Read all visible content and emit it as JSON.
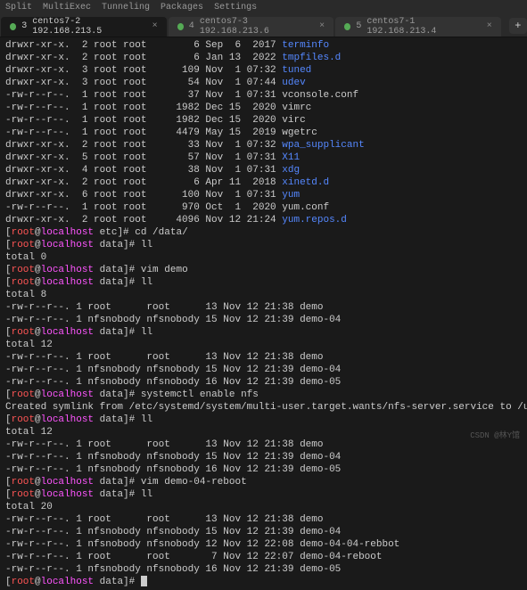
{
  "menubar": {
    "items": [
      "Split",
      "MultiExec",
      "Tunneling",
      "Packages",
      "Settings"
    ]
  },
  "tabs": [
    {
      "num": "3",
      "label": "centos7-2 192.168.213.5",
      "active": true
    },
    {
      "num": "4",
      "label": "centos7-3 192.168.213.6",
      "active": false
    },
    {
      "num": "5",
      "label": "centos7-1 192.168.213.4",
      "active": false
    }
  ],
  "ls1": [
    {
      "perm": "drwxr-xr-x.",
      "n": "2",
      "u": "root",
      "g": "root",
      "sz": "6",
      "mon": "Sep",
      "d": "6",
      "yt": "2017",
      "name": "terminfo",
      "cls": "blue"
    },
    {
      "perm": "drwxr-xr-x.",
      "n": "2",
      "u": "root",
      "g": "root",
      "sz": "6",
      "mon": "Jan",
      "d": "13",
      "yt": "2022",
      "name": "tmpfiles.d",
      "cls": "blue"
    },
    {
      "perm": "drwxr-xr-x.",
      "n": "3",
      "u": "root",
      "g": "root",
      "sz": "109",
      "mon": "Nov",
      "d": "1",
      "yt": "07:32",
      "name": "tuned",
      "cls": "blue"
    },
    {
      "perm": "drwxr-xr-x.",
      "n": "3",
      "u": "root",
      "g": "root",
      "sz": "54",
      "mon": "Nov",
      "d": "1",
      "yt": "07:44",
      "name": "udev",
      "cls": "blue"
    },
    {
      "perm": "-rw-r--r--.",
      "n": "1",
      "u": "root",
      "g": "root",
      "sz": "37",
      "mon": "Nov",
      "d": "1",
      "yt": "07:31",
      "name": "vconsole.conf",
      "cls": "white"
    },
    {
      "perm": "-rw-r--r--.",
      "n": "1",
      "u": "root",
      "g": "root",
      "sz": "1982",
      "mon": "Dec",
      "d": "15",
      "yt": "2020",
      "name": "vimrc",
      "cls": "white"
    },
    {
      "perm": "-rw-r--r--.",
      "n": "1",
      "u": "root",
      "g": "root",
      "sz": "1982",
      "mon": "Dec",
      "d": "15",
      "yt": "2020",
      "name": "virc",
      "cls": "white"
    },
    {
      "perm": "-rw-r--r--.",
      "n": "1",
      "u": "root",
      "g": "root",
      "sz": "4479",
      "mon": "May",
      "d": "15",
      "yt": "2019",
      "name": "wgetrc",
      "cls": "white"
    },
    {
      "perm": "drwxr-xr-x.",
      "n": "2",
      "u": "root",
      "g": "root",
      "sz": "33",
      "mon": "Nov",
      "d": "1",
      "yt": "07:32",
      "name": "wpa_supplicant",
      "cls": "blue"
    },
    {
      "perm": "drwxr-xr-x.",
      "n": "5",
      "u": "root",
      "g": "root",
      "sz": "57",
      "mon": "Nov",
      "d": "1",
      "yt": "07:31",
      "name": "X11",
      "cls": "blue"
    },
    {
      "perm": "drwxr-xr-x.",
      "n": "4",
      "u": "root",
      "g": "root",
      "sz": "38",
      "mon": "Nov",
      "d": "1",
      "yt": "07:31",
      "name": "xdg",
      "cls": "blue"
    },
    {
      "perm": "drwxr-xr-x.",
      "n": "2",
      "u": "root",
      "g": "root",
      "sz": "6",
      "mon": "Apr",
      "d": "11",
      "yt": "2018",
      "name": "xinetd.d",
      "cls": "blue"
    },
    {
      "perm": "drwxr-xr-x.",
      "n": "6",
      "u": "root",
      "g": "root",
      "sz": "100",
      "mon": "Nov",
      "d": "1",
      "yt": "07:31",
      "name": "yum",
      "cls": "blue"
    },
    {
      "perm": "-rw-r--r--.",
      "n": "1",
      "u": "root",
      "g": "root",
      "sz": "970",
      "mon": "Oct",
      "d": "1",
      "yt": "2020",
      "name": "yum.conf",
      "cls": "white"
    },
    {
      "perm": "drwxr-xr-x.",
      "n": "2",
      "u": "root",
      "g": "root",
      "sz": "4096",
      "mon": "Nov",
      "d": "12",
      "yt": "21:24",
      "name": "yum.repos.d",
      "cls": "blue"
    }
  ],
  "prompts": {
    "user": "root",
    "at": "@",
    "host": "localhost",
    "etc_cd": " etc]# cd /data/",
    "data_ll": " data]# ll",
    "data_vim_demo": " data]# vim demo",
    "data_systemctl": " data]# systemctl enable nfs",
    "data_vim_reboot": " data]# vim demo-04-reboot",
    "data_end": " data]# "
  },
  "totals": {
    "t0": "total 0",
    "t8": "total 8",
    "t12": "total 12",
    "t12b": "total 12",
    "t20": "total 20"
  },
  "ls_a": [
    {
      "perm": "-rw-r--r--.",
      "n": "1",
      "u": "root",
      "g": "root",
      "sz": "13",
      "mon": "Nov",
      "d": "12",
      "yt": "21:38",
      "name": "demo"
    },
    {
      "perm": "-rw-r--r--.",
      "n": "1",
      "u": "nfsnobody",
      "g": "nfsnobody",
      "sz": "15",
      "mon": "Nov",
      "d": "12",
      "yt": "21:39",
      "name": "demo-04"
    }
  ],
  "ls_b": [
    {
      "perm": "-rw-r--r--.",
      "n": "1",
      "u": "root",
      "g": "root",
      "sz": "13",
      "mon": "Nov",
      "d": "12",
      "yt": "21:38",
      "name": "demo"
    },
    {
      "perm": "-rw-r--r--.",
      "n": "1",
      "u": "nfsnobody",
      "g": "nfsnobody",
      "sz": "15",
      "mon": "Nov",
      "d": "12",
      "yt": "21:39",
      "name": "demo-04"
    },
    {
      "perm": "-rw-r--r--.",
      "n": "1",
      "u": "nfsnobody",
      "g": "nfsnobody",
      "sz": "16",
      "mon": "Nov",
      "d": "12",
      "yt": "21:39",
      "name": "demo-05"
    }
  ],
  "symlink_line": "Created symlink from /etc/systemd/system/multi-user.target.wants/nfs-server.service to /usr/lib/systemd/system.",
  "ls_c": [
    {
      "perm": "-rw-r--r--.",
      "n": "1",
      "u": "root",
      "g": "root",
      "sz": "13",
      "mon": "Nov",
      "d": "12",
      "yt": "21:38",
      "name": "demo"
    },
    {
      "perm": "-rw-r--r--.",
      "n": "1",
      "u": "nfsnobody",
      "g": "nfsnobody",
      "sz": "15",
      "mon": "Nov",
      "d": "12",
      "yt": "21:39",
      "name": "demo-04"
    },
    {
      "perm": "-rw-r--r--.",
      "n": "1",
      "u": "nfsnobody",
      "g": "nfsnobody",
      "sz": "16",
      "mon": "Nov",
      "d": "12",
      "yt": "21:39",
      "name": "demo-05"
    }
  ],
  "ls_d": [
    {
      "perm": "-rw-r--r--.",
      "n": "1",
      "u": "root",
      "g": "root",
      "sz": "13",
      "mon": "Nov",
      "d": "12",
      "yt": "21:38",
      "name": "demo"
    },
    {
      "perm": "-rw-r--r--.",
      "n": "1",
      "u": "nfsnobody",
      "g": "nfsnobody",
      "sz": "15",
      "mon": "Nov",
      "d": "12",
      "yt": "21:39",
      "name": "demo-04"
    },
    {
      "perm": "-rw-r--r--.",
      "n": "1",
      "u": "nfsnobody",
      "g": "nfsnobody",
      "sz": "12",
      "mon": "Nov",
      "d": "12",
      "yt": "22:08",
      "name": "demo-04-04-rebbot"
    },
    {
      "perm": "-rw-r--r--.",
      "n": "1",
      "u": "root",
      "g": "root",
      "sz": "7",
      "mon": "Nov",
      "d": "12",
      "yt": "22:07",
      "name": "demo-04-reboot"
    },
    {
      "perm": "-rw-r--r--.",
      "n": "1",
      "u": "nfsnobody",
      "g": "nfsnobody",
      "sz": "16",
      "mon": "Nov",
      "d": "12",
      "yt": "21:39",
      "name": "demo-05"
    }
  ],
  "watermark": "CSDN @林Y馆"
}
